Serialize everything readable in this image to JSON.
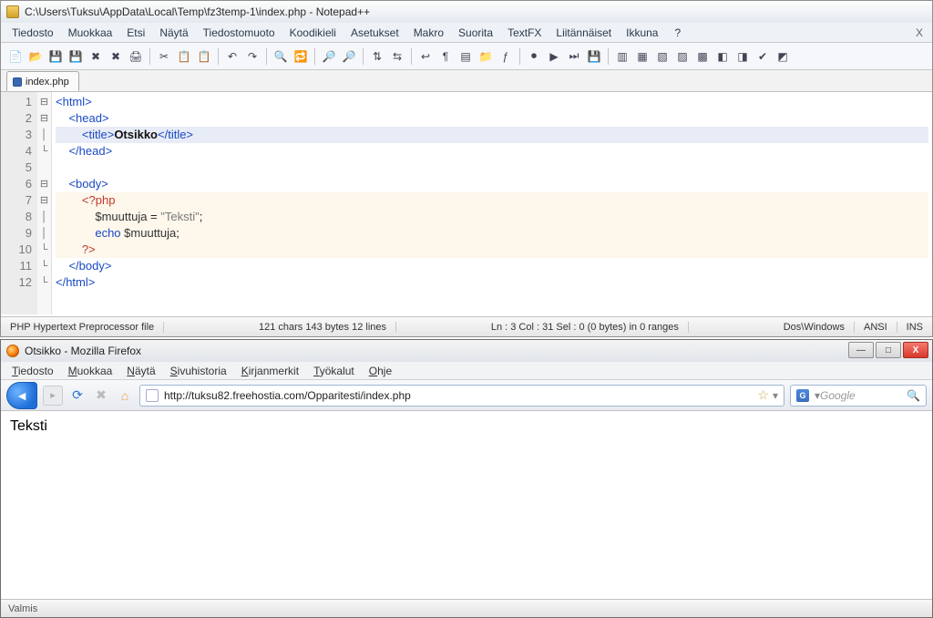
{
  "npp": {
    "title": "C:\\Users\\Tuksu\\AppData\\Local\\Temp\\fz3temp-1\\index.php - Notepad++",
    "menu": {
      "file": "Tiedosto",
      "edit": "Muokkaa",
      "search": "Etsi",
      "view": "Näytä",
      "format": "Tiedostomuoto",
      "language": "Koodikieli",
      "settings": "Asetukset",
      "macro": "Makro",
      "run": "Suorita",
      "textfx": "TextFX",
      "plugins": "Liitännäiset",
      "window": "Ikkuna",
      "help": "?",
      "close": "X"
    },
    "tab_label": "index.php",
    "code": {
      "l1": "<html>",
      "l2": "    <head>",
      "l3a": "        <title>",
      "l3b": "Otsikko",
      "l3c": "</title>",
      "l4": "    </head>",
      "l5": "",
      "l6": "    <body>",
      "l7a": "        ",
      "l7b": "<?php",
      "l8a": "            ",
      "l8b": "$muuttuja",
      "l8c": " = ",
      "l8d": "\"Teksti\"",
      "l8e": ";",
      "l9a": "            ",
      "l9b": "echo",
      "l9c": " ",
      "l9d": "$muuttuja",
      "l9e": ";",
      "l10a": "        ",
      "l10b": "?>",
      "l11": "    </body>",
      "l12": "</html>"
    },
    "gutter": {
      "n1": "1",
      "n2": "2",
      "n3": "3",
      "n4": "4",
      "n5": "5",
      "n6": "6",
      "n7": "7",
      "n8": "8",
      "n9": "9",
      "n10": "10",
      "n11": "11",
      "n12": "12"
    },
    "status": {
      "lang": "PHP Hypertext Preprocessor file",
      "length": "121 chars  143 bytes  12 lines",
      "pos": "Ln : 3   Col : 31   Sel : 0 (0 bytes) in 0 ranges",
      "eol": "Dos\\Windows",
      "enc": "ANSI",
      "mode": "INS"
    }
  },
  "ff": {
    "title": "Otsikko - Mozilla Firefox",
    "menu": {
      "file": "Tiedosto",
      "edit": "Muokkaa",
      "view": "Näytä",
      "history": "Sivuhistoria",
      "bookmarks": "Kirjanmerkit",
      "tools": "Työkalut",
      "help": "Ohje"
    },
    "url": "http://tuksu82.freehostia.com/Opparitesti/index.php",
    "search_placeholder": "Google",
    "page_text": "Teksti",
    "status": "Valmis",
    "winbtn": {
      "min": "—",
      "max": "□",
      "close": "X"
    }
  }
}
